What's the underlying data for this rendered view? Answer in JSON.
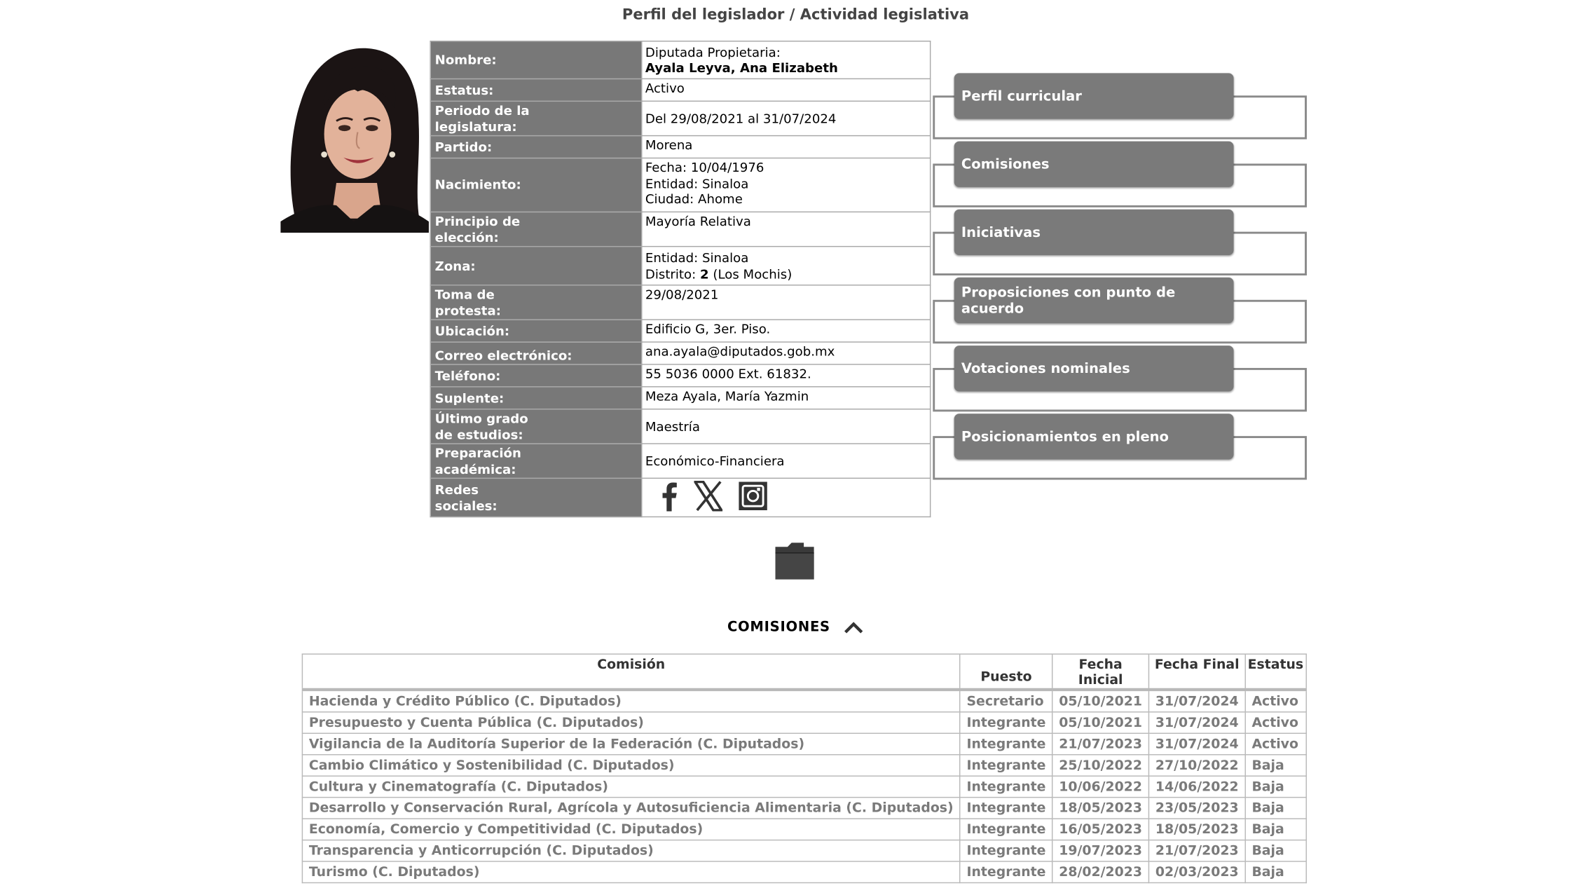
{
  "page_title": "Perfil del legislador / Actividad legislativa",
  "profile": {
    "nombre_label": "Nombre:",
    "nombre_line1": "Diputada Propietaria:",
    "nombre_line2": "Ayala Leyva, Ana Elizabeth",
    "estatus_label": "Estatus:",
    "estatus": "Activo",
    "periodo_label_1": "Periodo de la",
    "periodo_label_2": "legislatura:",
    "periodo": "Del 29/08/2021 al 31/07/2024",
    "partido_label": "Partido:",
    "partido": "Morena",
    "nacimiento_label": "Nacimiento:",
    "nac_fecha": "Fecha: 10/04/1976",
    "nac_entidad": "Entidad: Sinaloa",
    "nac_ciudad": "Ciudad: Ahome",
    "principio_label_1": "Principio de",
    "principio_label_2": "elección:",
    "principio": "Mayoría Relativa",
    "zona_label": "Zona:",
    "zona_entidad": "Entidad: Sinaloa",
    "zona_distrito_prefix": "Distrito:",
    "zona_distrito_num": "2",
    "zona_distrito_suffix": "(Los Mochis)",
    "toma_label_1": "Toma de",
    "toma_label_2": "protesta:",
    "toma": "29/08/2021",
    "ubicacion_label": "Ubicación:",
    "ubicacion": "Edificio G, 3er. Piso.",
    "correo_label": "Correo  electrónico:",
    "correo": "ana.ayala@diputados.gob.mx",
    "telefono_label": "Teléfono:",
    "telefono": "55 5036 0000 Ext. 61832.",
    "suplente_label": "Suplente:",
    "suplente": "Meza Ayala, María Yazmin",
    "grado_label_1": "Último grado",
    "grado_label_2": "de estudios:",
    "grado": "Maestría",
    "preparacion_label_1": "Preparación",
    "preparacion_label_2": "académica:",
    "preparacion": "Económico-Financiera",
    "redes_label_1": "Redes",
    "redes_label_2": "sociales:"
  },
  "menu": [
    "Perfil curricular",
    "Comisiones",
    "Iniciativas",
    "Proposiciones con punto de acuerdo",
    "Votaciones nominales",
    "Posicionamientos en pleno"
  ],
  "comisiones": {
    "heading": "COMISIONES",
    "headers": {
      "comision": "Comisión",
      "puesto": "Puesto",
      "inicial": "Fecha Inicial",
      "final": "Fecha Final",
      "estatus": "Estatus"
    },
    "rows": [
      [
        "Hacienda y Crédito Público (C. Diputados)",
        "Secretario",
        "05/10/2021",
        "31/07/2024",
        "Activo"
      ],
      [
        "Presupuesto y Cuenta Pública (C. Diputados)",
        "Integrante",
        "05/10/2021",
        "31/07/2024",
        "Activo"
      ],
      [
        "Vigilancia de la Auditoría Superior de la Federación (C. Diputados)",
        "Integrante",
        "21/07/2023",
        "31/07/2024",
        "Activo"
      ],
      [
        "Cambio Climático y Sostenibilidad (C. Diputados)",
        "Integrante",
        "25/10/2022",
        "27/10/2022",
        "Baja"
      ],
      [
        "Cultura y Cinematografía (C. Diputados)",
        "Integrante",
        "10/06/2022",
        "14/06/2022",
        "Baja"
      ],
      [
        "Desarrollo y Conservación Rural, Agrícola y Autosuficiencia Alimentaria (C. Diputados)",
        "Integrante",
        "18/05/2023",
        "23/05/2023",
        "Baja"
      ],
      [
        "Economía, Comercio y Competitividad (C. Diputados)",
        "Integrante",
        "16/05/2023",
        "18/05/2023",
        "Baja"
      ],
      [
        "Transparencia y Anticorrupción (C. Diputados)",
        "Integrante",
        "19/07/2023",
        "21/07/2023",
        "Baja"
      ],
      [
        "Turismo (C. Diputados)",
        "Integrante",
        "28/02/2023",
        "02/03/2023",
        "Baja"
      ]
    ]
  },
  "icons": {
    "social": [
      "facebook-icon",
      "x-icon",
      "instagram-icon"
    ],
    "folder": "folder-icon",
    "collapse": "chevron-up-icon"
  }
}
